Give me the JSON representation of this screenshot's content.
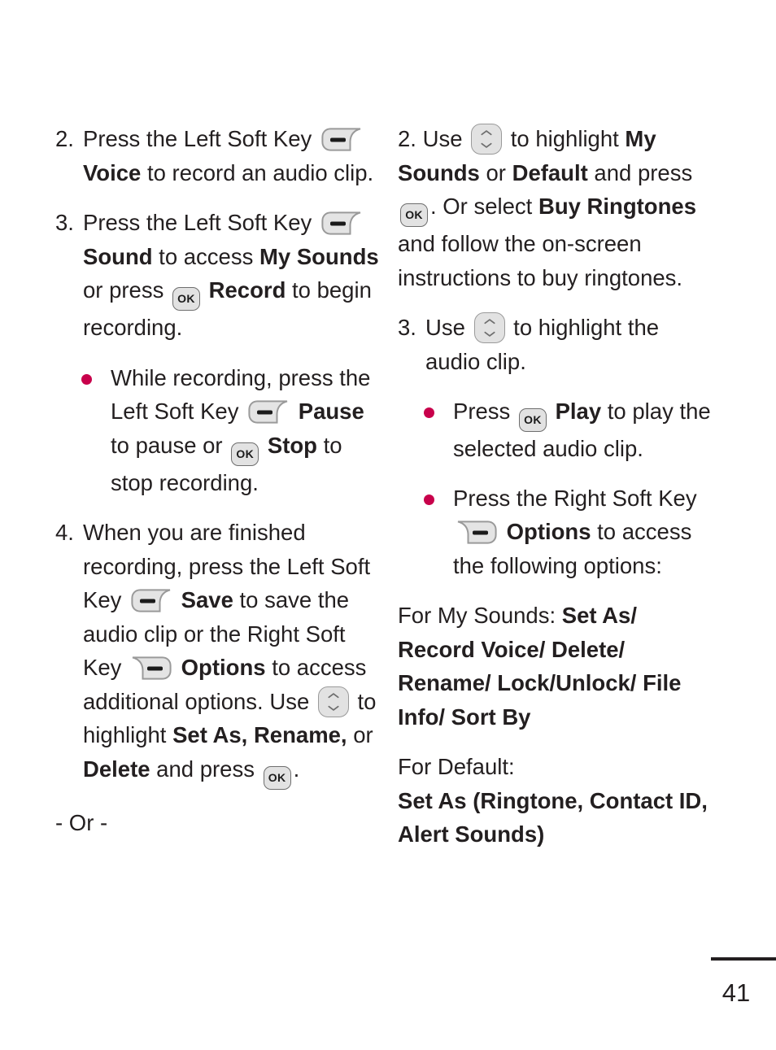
{
  "document": {
    "type": "mobile-phone-user-manual-page",
    "page_number": "41",
    "bullet_color": "#c8004b",
    "text_color": "#231f20"
  },
  "icons": {
    "left_soft_key": "left-soft-key-icon",
    "right_soft_key": "right-soft-key-icon",
    "ok_key": "ok-key-icon",
    "ok_label": "OK",
    "nav_key": "up-down-navigation-key-icon"
  },
  "left_column": {
    "step2": {
      "number": "2.",
      "t1": "Press the Left Soft Key ",
      "t2": "Voice",
      "t3": " to record an audio clip."
    },
    "step3": {
      "number": "3.",
      "t1": "Press the Left Soft Key ",
      "t2": "Sound",
      "t3": " to access ",
      "t4": "My Sounds",
      "t5": " or press ",
      "t6": "Record",
      "t7": " to begin recording."
    },
    "bullet1": {
      "t1": "While recording, press the Left Soft Key ",
      "t2": "Pause",
      "t3": " to pause or ",
      "t4": "Stop",
      "t5": " to stop recording."
    },
    "step4": {
      "number": "4.",
      "t1": "When you are finished recording, press the Left Soft Key ",
      "t2": "Save",
      "t3": " to save the audio clip or the Right Soft Key ",
      "t4": "Options",
      "t5": " to access additional options. Use ",
      "t6": " to highlight ",
      "t7": "Set As, Rename,",
      "t8": " or ",
      "t9": "Delete",
      "t10": " and press ",
      "t11": "."
    },
    "or_divider": "- Or -"
  },
  "right_column": {
    "step2": {
      "number": "2.",
      "t1": "Use ",
      "t2": " to highlight ",
      "t3": "My Sounds",
      "t4": " or ",
      "t5": "Default",
      "t6": " and press ",
      "t7": ". Or select ",
      "t8": "Buy Ringtones",
      "t9": " and follow the on-screen instructions to buy ringtones."
    },
    "step3": {
      "number": "3.",
      "t1": "Use ",
      "t2": " to highlight the audio clip."
    },
    "bullet1": {
      "t1": "Press ",
      "t2": "Play",
      "t3": " to play the selected audio clip."
    },
    "bullet2": {
      "t1": "Press the Right Soft Key ",
      "t2": "Options",
      "t3": " to access the following options:"
    },
    "my_sounds_options": {
      "label": "For My Sounds: ",
      "value": "Set As/ Record Voice/ Delete/ Rename/ Lock/Unlock/ File Info/ Sort By"
    },
    "default_options": {
      "label": "For Default:",
      "value": "Set As (Ringtone, Contact ID, Alert Sounds)"
    }
  }
}
